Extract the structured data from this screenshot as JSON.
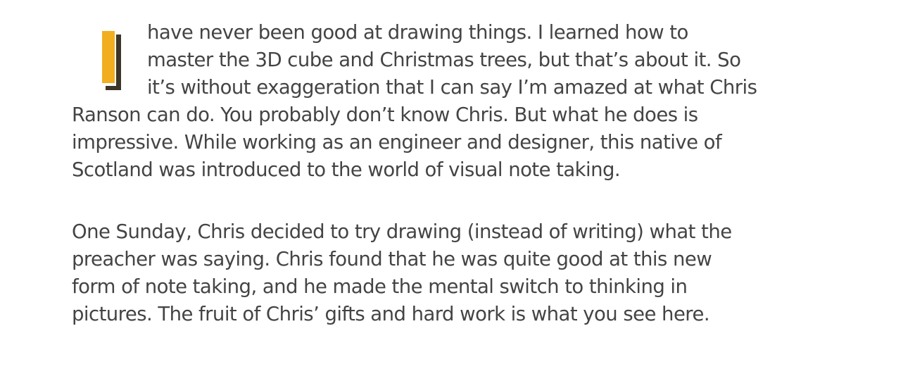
{
  "article": {
    "drop_cap": {
      "letter": "I",
      "fill_color": "#f2ae21",
      "shadow_color": "#3d3528"
    },
    "paragraphs": [
      {
        "lines": [
          "have never been good at drawing things. I learned how to",
          "master the 3D cube and Christmas trees, but that’s about it. So",
          "it’s without exaggeration that I can say I’m amazed at what Chris",
          "Ranson can do. You probably don’t know Chris. But what he does is",
          "impressive. While working as an engineer and designer, this native of",
          "Scotland was introduced to the world of visual note taking."
        ]
      },
      {
        "lines": [
          "One Sunday, Chris decided to try drawing (instead of writing) what the",
          "preacher was saying. Chris found that he was quite good at this new",
          "form of note taking, and he made the mental switch to thinking in",
          "pictures. The fruit of Chris’ gifts and hard work is what you see here."
        ]
      }
    ]
  }
}
